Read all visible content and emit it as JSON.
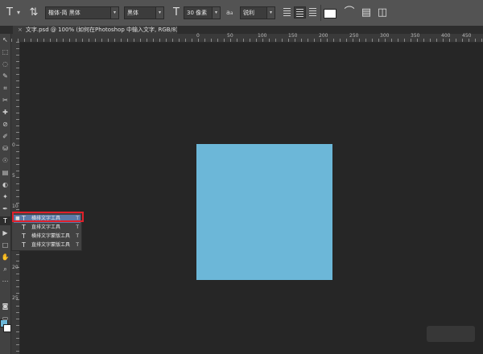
{
  "options_bar": {
    "font_family": "楷体-简 黑体",
    "font_style": "黑体",
    "font_size": "30 像素",
    "aa_label": "a",
    "aa_sub": "a",
    "antialias": "锐利",
    "text_color": "#ffffff"
  },
  "tab": {
    "close": "×",
    "title": "文字.psd @ 100% (如何在Photoshop 中输入文字, RGB/8) *"
  },
  "ruler": {
    "h_labels": [
      "0",
      "50",
      "100",
      "150",
      "200",
      "250",
      "300",
      "350",
      "400",
      "450",
      "500",
      "550"
    ],
    "v_labels": [
      "0",
      "5",
      "10",
      "15",
      "20",
      "25",
      "30",
      "35"
    ]
  },
  "toolbar": {
    "tools": [
      "↖",
      "⬚",
      "◌",
      "✎",
      "⌗",
      "✂",
      "✚",
      "⊘",
      "✐",
      "⛁",
      "☉",
      "▤",
      "◐",
      "✦",
      "✒",
      "T",
      "▶",
      "□",
      "✋",
      "⌕",
      "⋯"
    ]
  },
  "canvas": {
    "doc_color": "#6cb7d8"
  },
  "flyout": {
    "items": [
      {
        "bullet": "■",
        "icon": "T",
        "label": "横排文字工具",
        "key": "T"
      },
      {
        "bullet": "",
        "icon": "T",
        "label": "直排文字工具",
        "key": "T"
      },
      {
        "bullet": "",
        "icon": "T",
        "label": "横排文字蒙版工具",
        "key": "T"
      },
      {
        "bullet": "",
        "icon": "T",
        "label": "直排文字蒙版工具",
        "key": "T"
      }
    ]
  },
  "colors": {
    "foreground": "#6cb7d8",
    "background": "#ffffff",
    "highlight": "#e0202a",
    "selection": "#5b7aa8"
  },
  "icons": {
    "type_tool": "type-icon",
    "orientation": "text-orientation-icon",
    "warp": "warp-text-icon",
    "panels": "character-panel-icon",
    "three_d": "3d-icon"
  }
}
